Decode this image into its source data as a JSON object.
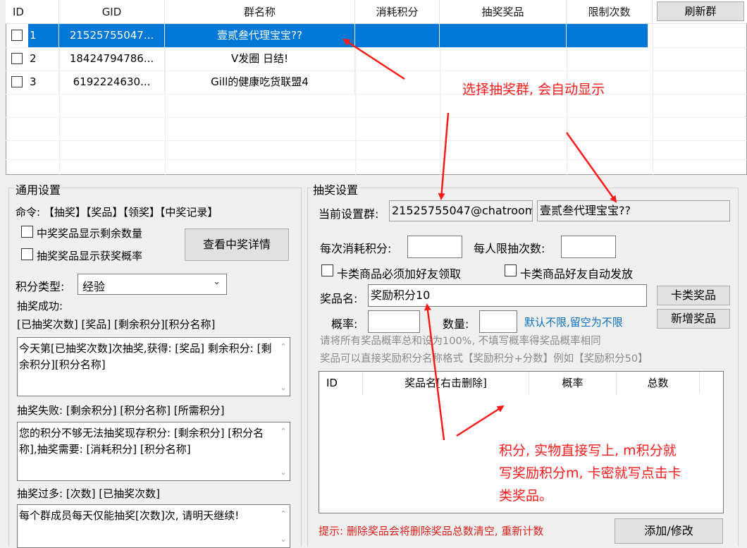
{
  "table": {
    "headers": [
      "ID",
      "GID",
      "群名称",
      "消耗积分",
      "抽奖奖品",
      "限制次数"
    ],
    "refresh_label": "刷新群",
    "rows": [
      {
        "id": "1",
        "gid": "21525755047...",
        "name": "壹贰叁代理宝宝??",
        "selected": true
      },
      {
        "id": "2",
        "gid": "18424794786...",
        "name": "V发圈 日结!"
      },
      {
        "id": "3",
        "gid": "6192224630...",
        "name": "Gill的健康吃货联盟4"
      }
    ]
  },
  "general": {
    "title": "通用设置",
    "commands": "命令: 【抽奖】【奖品】【领奖】【中奖记录】",
    "chk_remaining": "中奖奖品显示剩余数量",
    "chk_probability": "抽奖奖品显示获奖概率",
    "view_details": "查看中奖详情",
    "points_type_label": "积分类型:",
    "points_type_value": "经验",
    "success_label": "抽奖成功:",
    "success_vars": "[已抽奖次数] [奖品] [剩余积分][积分名称]",
    "success_text": "今天第[已抽奖次数]次抽奖,获得: [奖品] 剩余积分: [剩余积分][积分名称]",
    "fail_label": "抽奖失败: [剩余积分] [积分名称] [所需积分]",
    "fail_text": "您的积分不够无法抽奖现存积分: [剩余积分] [积分名称],抽奖需要: [消耗积分] [积分名称]",
    "toomany_label": "抽奖过多: [次数] [已抽奖次数]",
    "toomany_text": "每个群成员每天仅能抽奖[次数]次, 请明天继续!"
  },
  "lottery": {
    "title": "抽奖设置",
    "current_group_label": "当前设置群:",
    "current_group_id": "21525755047@chatroom",
    "current_group_name": "壹贰叁代理宝宝??",
    "cost_label": "每次消耗积分:",
    "limit_label": "每人限抽次数:",
    "chk_friend_required": "卡类商品必须加好友领取",
    "chk_auto_send": "卡类商品好友自动发放",
    "prize_name_label": "奖品名:",
    "prize_name_value": "奖励积分10",
    "card_prize_btn": "卡类奖品",
    "prob_label": "概率:",
    "qty_label": "数量:",
    "default_hint": "默认不限,留空为不限",
    "add_prize_btn": "新增奖品",
    "note1": "请将所有奖品概率总和设为100%, 不填写概率得奖品概率相同",
    "note2": "奖品可以直接奖励积分名称格式【奖励积分+分数】例如【奖励积分50】",
    "list_headers": [
      "ID",
      "奖品名[右击删除]",
      "概率",
      "总数"
    ],
    "tip": "提示: 删除奖品会将删除奖品总数清空, 重新计数",
    "add_modify_btn": "添加/修改"
  },
  "annotations": {
    "select_group": "选择抽奖群, 会自动显示",
    "points_line1": "积分, 实物直接写上, m积分就",
    "points_line2": "写奖励积分m, 卡密就写点击卡",
    "points_line3": "类奖品。"
  },
  "colors": {
    "selection": "#0078d7",
    "annotation": "#ff1a1a",
    "hint_blue": "#0a6fc2"
  }
}
